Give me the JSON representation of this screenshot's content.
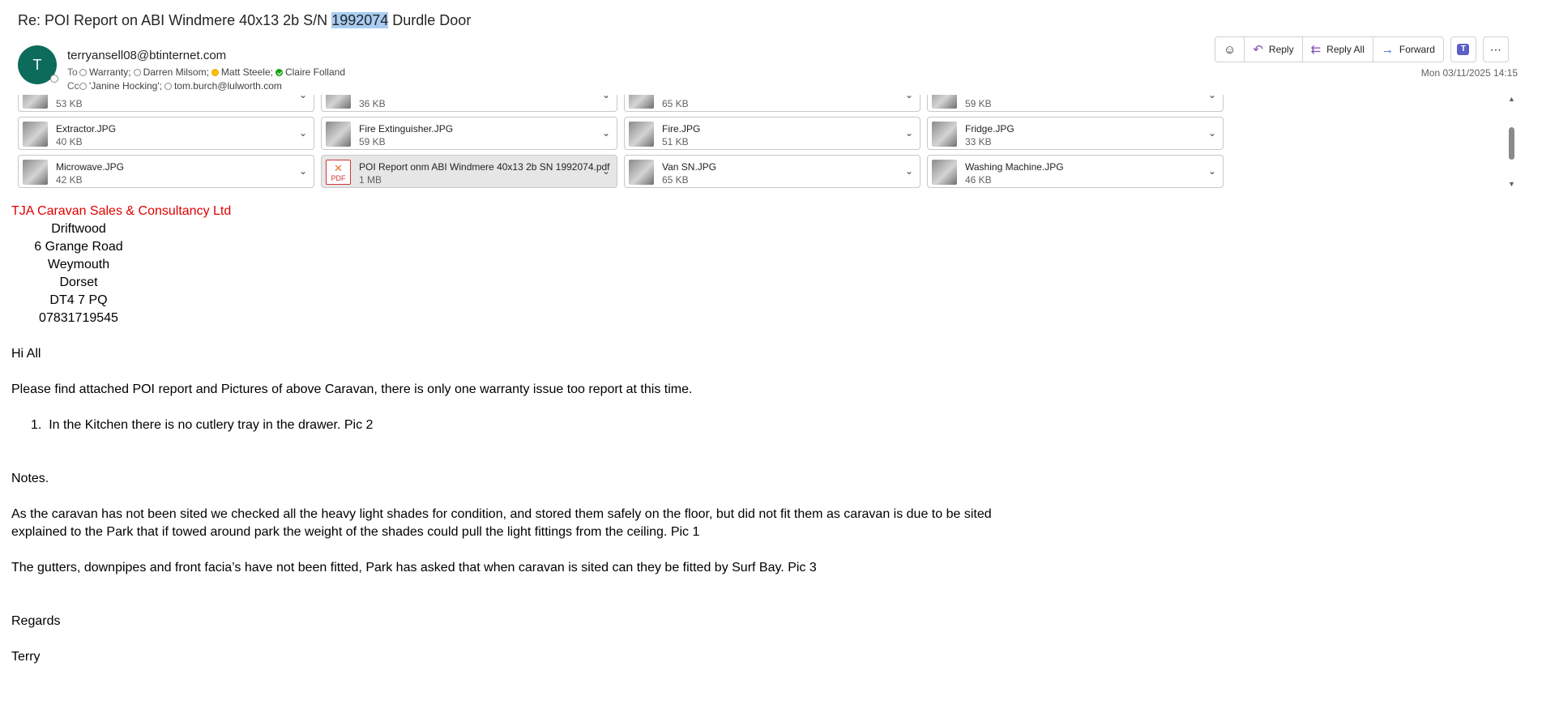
{
  "email": {
    "subject_prefix": "Re: POI Report on ABI Windmere 40x13 2b S/N ",
    "subject_highlight": "1992074",
    "subject_suffix": " Durdle Door",
    "avatar_initial": "T",
    "sender": "terryansell08@btinternet.com",
    "to_label": "To",
    "to": [
      {
        "name": "Warranty;",
        "presence": "offline"
      },
      {
        "name": "Darren Milsom;",
        "presence": "offline"
      },
      {
        "name": "Matt Steele;",
        "presence": "away"
      },
      {
        "name": "Claire Folland",
        "presence": "available"
      }
    ],
    "cc_label": "Cc",
    "cc": [
      {
        "name": "'Janine Hocking';",
        "presence": "offline"
      },
      {
        "name": "tom.burch@lulworth.com",
        "presence": "offline"
      }
    ],
    "datetime": "Mon 03/11/2025 14:15"
  },
  "actions": {
    "emoji_icon": "smiley-icon",
    "reply": "Reply",
    "reply_all": "Reply All",
    "forward": "Forward",
    "teams_icon": "teams-icon",
    "more_icon": "more-icon"
  },
  "attachments": [
    {
      "name": "",
      "size": "53 KB",
      "type": "image"
    },
    {
      "name": "",
      "size": "36 KB",
      "type": "image"
    },
    {
      "name": "",
      "size": "65 KB",
      "type": "image"
    },
    {
      "name": "",
      "size": "59 KB",
      "type": "image"
    },
    {
      "name": "Extractor.JPG",
      "size": "40 KB",
      "type": "image"
    },
    {
      "name": "Fire Extinguisher.JPG",
      "size": "59 KB",
      "type": "image"
    },
    {
      "name": "Fire.JPG",
      "size": "51 KB",
      "type": "image"
    },
    {
      "name": "Fridge.JPG",
      "size": "33 KB",
      "type": "image"
    },
    {
      "name": "Microwave.JPG",
      "size": "42 KB",
      "type": "image"
    },
    {
      "name": "POI Report onm ABI Windmere 40x13 2b SN 1992074.pdf",
      "size": "1 MB",
      "type": "pdf",
      "selected": true
    },
    {
      "name": "Van SN.JPG",
      "size": "65 KB",
      "type": "image"
    },
    {
      "name": "Washing Machine.JPG",
      "size": "46 KB",
      "type": "image"
    }
  ],
  "body": {
    "company": "TJA Caravan Sales & Consultancy Ltd",
    "address": [
      "Driftwood",
      "6 Grange Road",
      "Weymouth",
      "Dorset",
      "DT4 7 PQ",
      "07831719545"
    ],
    "greeting": "Hi All",
    "intro": "Please find attached POI report and Pictures of above Caravan, there is only one warranty issue too report at this time.",
    "list_num": "1.",
    "list_item": "In the Kitchen there is no cutlery tray in the drawer. Pic 2",
    "notes": "Notes.",
    "notes_line1": "As the caravan has not been sited we checked all the heavy light shades for condition, and stored them safely on the floor, but did not fit them as caravan is due to be sited",
    "notes_line2": "explained to the Park that if towed around park the weight of the shades could pull the light fittings from the ceiling. Pic 1",
    "gutters": "The gutters, downpipes and front facia’s have not been fitted, Park has asked that when caravan is sited can they be fitted by Surf Bay. Pic 3",
    "regards": "Regards",
    "signature": "Terry"
  }
}
